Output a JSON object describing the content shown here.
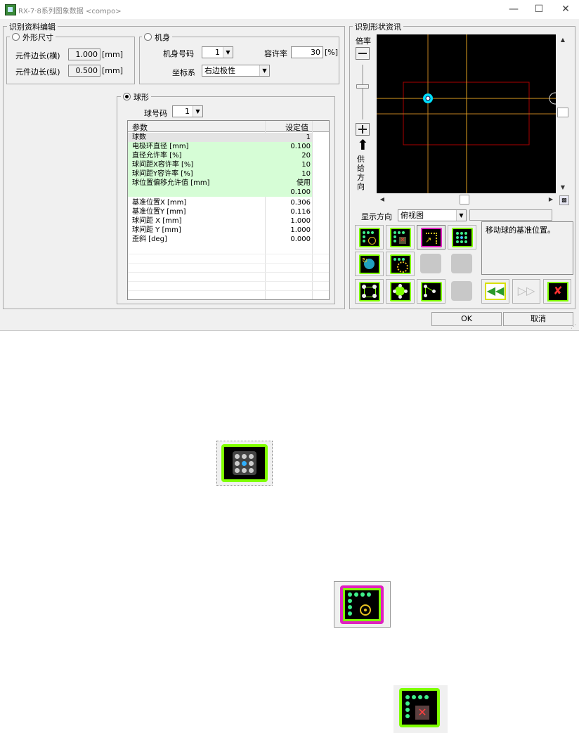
{
  "window": {
    "title": "RX-7·8系列图象数据 <compo>",
    "controls": {
      "minimize": "—",
      "maximize": "☐",
      "close": "✕"
    }
  },
  "edit_group": {
    "label": "识别资料编辑"
  },
  "outline_group": {
    "label": "外形尺寸",
    "length_h_label": "元件边长(横)",
    "length_h_value": "1.000",
    "length_h_unit": "[mm]",
    "length_v_label": "元件边长(纵)",
    "length_v_value": "0.500",
    "length_v_unit": "[mm]"
  },
  "body_group": {
    "label": "机身",
    "body_no_label": "机身号码",
    "body_no_value": "1",
    "tolerance_label": "容许率",
    "tolerance_value": "30",
    "tolerance_unit": "[%]",
    "coord_label": "坐标系",
    "coord_value": "右边极性"
  },
  "ball_group": {
    "label": "球形",
    "ball_no_label": "球号码",
    "ball_no_value": "1"
  },
  "params_table": {
    "headers": [
      "参数",
      "设定值"
    ],
    "rows": [
      {
        "name": "球数",
        "value": "1"
      },
      {
        "name": "电极环直径 [mm]",
        "value": "0.100"
      },
      {
        "name": "直径允许率 [%]",
        "value": "20"
      },
      {
        "name": "球间距X容许率 [%]",
        "value": "10"
      },
      {
        "name": "球间距Y容许率 [%]",
        "value": "10"
      },
      {
        "name": "球位置偏移允许值 [mm]",
        "value": "使用"
      },
      {
        "name": "",
        "value": "0.100"
      },
      {
        "name": "基准位置X [mm]",
        "value": "0.306"
      },
      {
        "name": "基准位置Y [mm]",
        "value": "0.116"
      },
      {
        "name": "球间距 X [mm]",
        "value": "1.000"
      },
      {
        "name": "球间距 Y [mm]",
        "value": "1.000"
      },
      {
        "name": "歪斜 [deg]",
        "value": "0.000"
      }
    ]
  },
  "shape_group": {
    "label": "识别形状资讯",
    "zoom_label": "倍率",
    "feed_label": [
      "供",
      "给",
      "方",
      "向"
    ],
    "view_dir_label": "显示方向",
    "view_dir_value": "俯视图",
    "message": "移动球的基准位置。"
  },
  "buttons": {
    "ok": "OK",
    "cancel": "取消"
  },
  "colors": {
    "green_rows": "#d6fdd6",
    "icon_border": "#7fff00",
    "crosshair": "#e0a020",
    "marker": "#00e0ff",
    "body_rect": "#aa0000"
  }
}
